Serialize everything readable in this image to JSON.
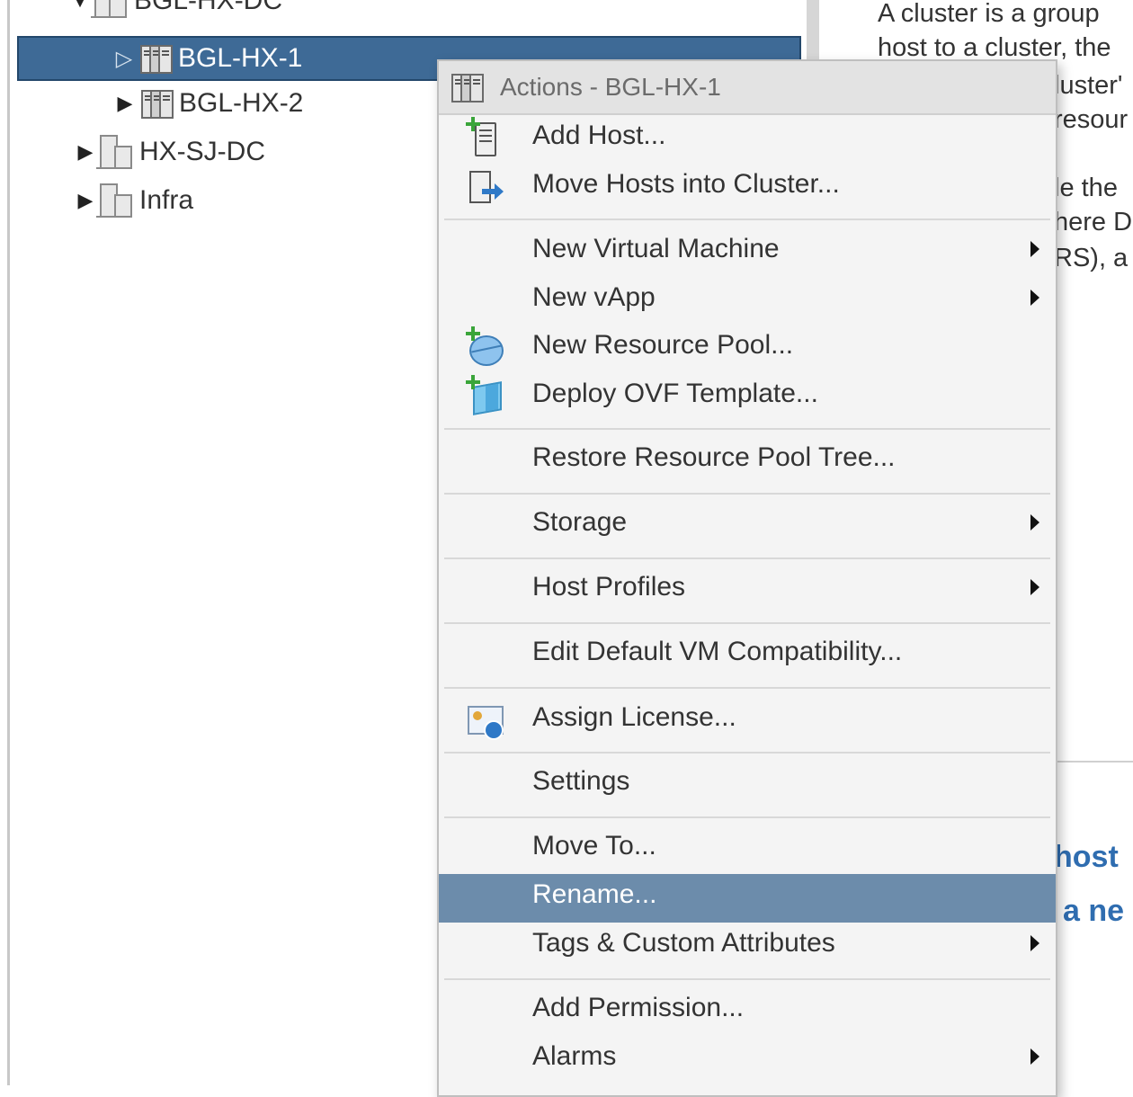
{
  "tree": {
    "items": [
      {
        "label": "BGL-HX-DC"
      },
      {
        "label": "BGL-HX-1"
      },
      {
        "label": "BGL-HX-2"
      },
      {
        "label": "HX-SJ-DC"
      },
      {
        "label": "Infra"
      }
    ]
  },
  "description": {
    "lines": [
      "A cluster is a group",
      "host to a cluster, the",
      "luster'",
      "resour",
      "le the",
      "here D",
      "RS), a"
    ],
    "links": [
      "host",
      "a ne"
    ]
  },
  "menu": {
    "title": "Actions - BGL-HX-1",
    "items": {
      "add_host": "Add Host...",
      "move_hosts": "Move Hosts into Cluster...",
      "new_vm": "New Virtual Machine",
      "new_vapp": "New vApp",
      "new_pool": "New Resource Pool...",
      "deploy_ovf": "Deploy OVF Template...",
      "restore_pool": "Restore Resource Pool Tree...",
      "storage": "Storage",
      "host_profiles": "Host Profiles",
      "edit_vm_compat": "Edit Default VM Compatibility...",
      "assign_license": "Assign License...",
      "settings": "Settings",
      "move_to": "Move To...",
      "rename": "Rename...",
      "tags": "Tags & Custom Attributes",
      "add_permission": "Add Permission...",
      "alarms": "Alarms"
    },
    "selected_item": "Rename...",
    "colors": {
      "selection": "#6c8cab",
      "tree_selection": "#3e6a96"
    }
  }
}
